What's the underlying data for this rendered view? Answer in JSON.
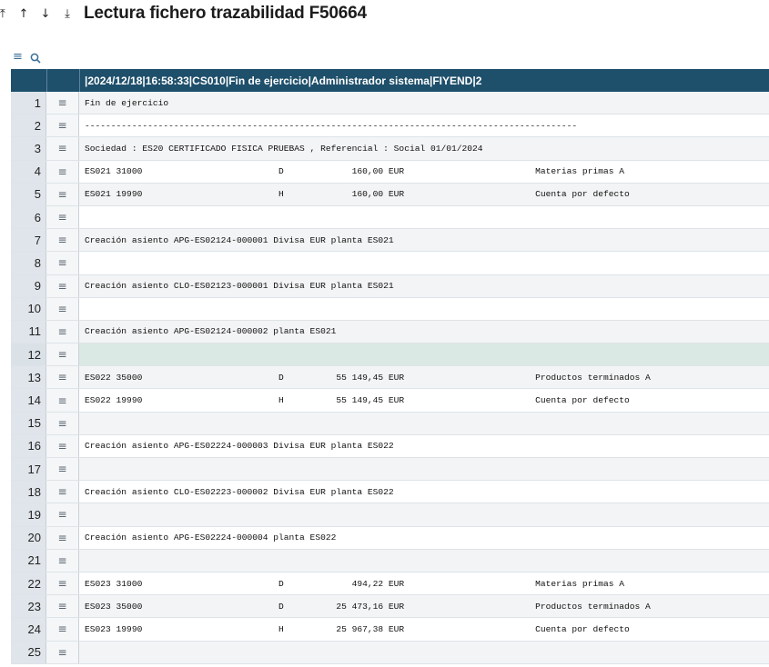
{
  "toolbar": {
    "first_icon": "⤒",
    "up_icon": "↑",
    "down_icon": "↓",
    "last_icon": "⤓",
    "title": "Lectura fichero trazabilidad F50664"
  },
  "grid_tools": {
    "menu_icon": "≡",
    "search_icon": "🔍"
  },
  "table": {
    "header_text": "|2024/12/18|16:58:33|CS010|Fin de ejercicio|Administrador sistema|FIYEND|2",
    "row_menu_icon": "≡",
    "rows": [
      {
        "num": "1",
        "text": "Fin de ejercicio"
      },
      {
        "num": "2",
        "text": "----------------------------------------------------------------------------------------------"
      },
      {
        "num": "3",
        "text": "Sociedad : ES20 CERTIFICADO FISICA PRUEBAS , Referencial : Social 01/01/2024"
      },
      {
        "num": "4",
        "text": "ES021 31000                          D             160,00 EUR                         Materias primas A"
      },
      {
        "num": "5",
        "text": "ES021 19990                          H             160,00 EUR                         Cuenta por defecto"
      },
      {
        "num": "6",
        "text": ""
      },
      {
        "num": "7",
        "text": "Creación asiento APG-ES02124-000001 Divisa EUR planta ES021"
      },
      {
        "num": "8",
        "text": ""
      },
      {
        "num": "9",
        "text": "Creación asiento CLO-ES02123-000001 Divisa EUR planta ES021"
      },
      {
        "num": "10",
        "text": ""
      },
      {
        "num": "11",
        "text": "Creación asiento APG-ES02124-000002 planta ES021"
      },
      {
        "num": "12",
        "text": ""
      },
      {
        "num": "13",
        "text": "ES022 35000                          D          55 149,45 EUR                         Productos terminados A"
      },
      {
        "num": "14",
        "text": "ES022 19990                          H          55 149,45 EUR                         Cuenta por defecto"
      },
      {
        "num": "15",
        "text": ""
      },
      {
        "num": "16",
        "text": "Creación asiento APG-ES02224-000003 Divisa EUR planta ES022"
      },
      {
        "num": "17",
        "text": ""
      },
      {
        "num": "18",
        "text": "Creación asiento CLO-ES02223-000002 Divisa EUR planta ES022"
      },
      {
        "num": "19",
        "text": ""
      },
      {
        "num": "20",
        "text": "Creación asiento APG-ES02224-000004 planta ES022"
      },
      {
        "num": "21",
        "text": ""
      },
      {
        "num": "22",
        "text": "ES023 31000                          D             494,22 EUR                         Materias primas A"
      },
      {
        "num": "23",
        "text": "ES023 35000                          D          25 473,16 EUR                         Productos terminados A"
      },
      {
        "num": "24",
        "text": "ES023 19990                          H          25 967,38 EUR                         Cuenta por defecto"
      },
      {
        "num": "25",
        "text": ""
      }
    ]
  },
  "colors": {
    "header_bg": "#1e4f6b",
    "row_num_bg": "#dfe5ea",
    "selected_row_bg": "#dbe9e5"
  }
}
